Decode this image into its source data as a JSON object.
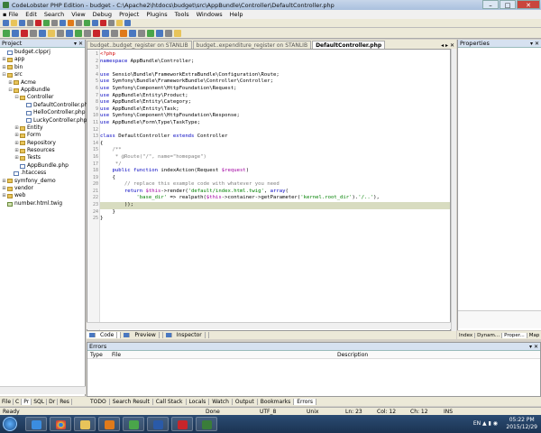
{
  "window": {
    "title": "CodeLobster PHP Edition - budget - C:\\Apache2\\htdocs\\budget\\src\\AppBundle\\Controller\\DefaultController.php"
  },
  "menu": [
    "File",
    "Edit",
    "Search",
    "View",
    "Debug",
    "Project",
    "Plugins",
    "Tools",
    "Windows",
    "Help"
  ],
  "project_panel": {
    "title": "Project",
    "tree": [
      {
        "label": "budget.clpprj",
        "depth": 0,
        "kind": "file",
        "exp": ""
      },
      {
        "label": "app",
        "depth": 0,
        "kind": "folder",
        "exp": "+"
      },
      {
        "label": "bin",
        "depth": 0,
        "kind": "folder",
        "exp": "+"
      },
      {
        "label": "src",
        "depth": 0,
        "kind": "folder",
        "exp": "-"
      },
      {
        "label": "Acme",
        "depth": 1,
        "kind": "folder",
        "exp": "+"
      },
      {
        "label": "AppBundle",
        "depth": 1,
        "kind": "folder",
        "exp": "-"
      },
      {
        "label": "Controller",
        "depth": 2,
        "kind": "folder",
        "exp": "-"
      },
      {
        "label": "DefaultController.php",
        "depth": 3,
        "kind": "file",
        "exp": ""
      },
      {
        "label": "HelloController.php",
        "depth": 3,
        "kind": "file",
        "exp": ""
      },
      {
        "label": "LuckyController.php",
        "depth": 3,
        "kind": "file",
        "exp": ""
      },
      {
        "label": "Entity",
        "depth": 2,
        "kind": "folder",
        "exp": "+"
      },
      {
        "label": "Form",
        "depth": 2,
        "kind": "folder",
        "exp": "+"
      },
      {
        "label": "Repository",
        "depth": 2,
        "kind": "folder",
        "exp": "+"
      },
      {
        "label": "Resources",
        "depth": 2,
        "kind": "folder",
        "exp": "+"
      },
      {
        "label": "Tests",
        "depth": 2,
        "kind": "folder",
        "exp": "+"
      },
      {
        "label": "AppBundle.php",
        "depth": 2,
        "kind": "file",
        "exp": ""
      },
      {
        "label": ".htaccess",
        "depth": 1,
        "kind": "file",
        "exp": ""
      },
      {
        "label": "symfony_demo",
        "depth": 0,
        "kind": "folder",
        "exp": "+"
      },
      {
        "label": "vendor",
        "depth": 0,
        "kind": "folder",
        "exp": "+"
      },
      {
        "label": "web",
        "depth": 0,
        "kind": "folder",
        "exp": "+"
      },
      {
        "label": "number.html.twig",
        "depth": 0,
        "kind": "twig",
        "exp": ""
      }
    ],
    "tabs": [
      "File",
      "C",
      "Pr",
      "SQL",
      "Dr",
      "Res"
    ]
  },
  "editor": {
    "tabs": [
      "budget..budget_register on STANLIB",
      "budget..expenditure_register on STANLIB",
      "DefaultController.php"
    ],
    "active_tab": 2,
    "view_tabs": [
      "Code",
      "Preview",
      "Inspector"
    ],
    "lines": [
      {
        "n": "1",
        "parts": [
          [
            "ph",
            "<?php"
          ]
        ]
      },
      {
        "n": "2",
        "parts": [
          [
            "kw",
            "namespace"
          ],
          [
            "",
            " AppBundle\\Controller;"
          ]
        ]
      },
      {
        "n": "3",
        "parts": []
      },
      {
        "n": "4",
        "parts": [
          [
            "kw",
            "use"
          ],
          [
            "",
            " Sensio\\Bundle\\FrameworkExtraBundle\\Configuration\\Route;"
          ]
        ]
      },
      {
        "n": "5",
        "parts": [
          [
            "kw",
            "use"
          ],
          [
            "",
            " Symfony\\Bundle\\FrameworkBundle\\Controller\\Controller;"
          ]
        ]
      },
      {
        "n": "6",
        "parts": [
          [
            "kw",
            "use"
          ],
          [
            "",
            " Symfony\\Component\\HttpFoundation\\Request;"
          ]
        ]
      },
      {
        "n": "7",
        "parts": [
          [
            "kw",
            "use"
          ],
          [
            "",
            " AppBundle\\Entity\\Product;"
          ]
        ]
      },
      {
        "n": "8",
        "parts": [
          [
            "kw",
            "use"
          ],
          [
            "",
            " AppBundle\\Entity\\Category;"
          ]
        ]
      },
      {
        "n": "9",
        "parts": [
          [
            "kw",
            "use"
          ],
          [
            "",
            " AppBundle\\Entity\\Task;"
          ]
        ]
      },
      {
        "n": "10",
        "parts": [
          [
            "kw",
            "use"
          ],
          [
            "",
            " Symfony\\Component\\HttpFoundation\\Response;"
          ]
        ]
      },
      {
        "n": "11",
        "parts": [
          [
            "kw",
            "use"
          ],
          [
            "",
            " AppBundle\\Form\\Type\\TaskType;"
          ]
        ]
      },
      {
        "n": "12",
        "parts": []
      },
      {
        "n": "13",
        "parts": [
          [
            "kw",
            "class"
          ],
          [
            "",
            " DefaultController "
          ],
          [
            "kw",
            "extends"
          ],
          [
            "",
            " Controller"
          ]
        ]
      },
      {
        "n": "14",
        "parts": [
          [
            "",
            "{"
          ]
        ]
      },
      {
        "n": "15",
        "parts": [
          [
            "cm",
            "    /**"
          ]
        ]
      },
      {
        "n": "16",
        "parts": [
          [
            "cm",
            "     * @Route(\"/\", name=\"homepage\")"
          ]
        ]
      },
      {
        "n": "17",
        "parts": [
          [
            "cm",
            "     */"
          ]
        ]
      },
      {
        "n": "18",
        "parts": [
          [
            "kw",
            "    public function"
          ],
          [
            "",
            " indexAction(Request "
          ],
          [
            "vr",
            "$request"
          ],
          [
            "",
            ")"
          ]
        ]
      },
      {
        "n": "19",
        "parts": [
          [
            "",
            "    {"
          ]
        ]
      },
      {
        "n": "20",
        "parts": [
          [
            "cm",
            "        // replace this example code with whatever you need"
          ]
        ]
      },
      {
        "n": "21",
        "parts": [
          [
            "kw",
            "        return"
          ],
          [
            "",
            " "
          ],
          [
            "vr",
            "$this"
          ],
          [
            "",
            "->render("
          ],
          [
            "st",
            "'default/index.html.twig'"
          ],
          [
            "",
            ", "
          ],
          [
            "kw",
            "array"
          ],
          [
            "",
            "("
          ]
        ]
      },
      {
        "n": "22",
        "parts": [
          [
            "st",
            "            'base_dir'"
          ],
          [
            "",
            " => realpath("
          ],
          [
            "vr",
            "$this"
          ],
          [
            "",
            "->container->getParameter("
          ],
          [
            "st",
            "'kernel.root_dir'"
          ],
          [
            "",
            ")."
          ],
          [
            "st",
            "'/..'"
          ],
          [
            "",
            "),"
          ]
        ]
      },
      {
        "n": "23",
        "parts": [
          [
            "",
            "        ));"
          ]
        ],
        "highlight": true
      },
      {
        "n": "24",
        "parts": [
          [
            "",
            "    }"
          ]
        ]
      },
      {
        "n": "25",
        "parts": [
          [
            "",
            "}"
          ]
        ]
      }
    ]
  },
  "properties_panel": {
    "title": "Properties",
    "tabs": [
      "Index",
      "Dynam...",
      "Proper...",
      "Map"
    ]
  },
  "errors_panel": {
    "title": "Errors",
    "columns": [
      "Type",
      "File",
      "Description"
    ]
  },
  "bottom_tabs": [
    "TODO",
    "Search Result",
    "Call Stack",
    "Locals",
    "Watch",
    "Output",
    "Bookmarks",
    "Errors"
  ],
  "status": {
    "state": "Ready",
    "done": "Done",
    "encoding": "UTF_8",
    "eol": "Unix",
    "line": "Ln: 23",
    "col": "Col: 12",
    "ch": "Ch: 12",
    "mode": "INS"
  },
  "taskbar": {
    "language": "EN",
    "time": "05:22 PM",
    "date": "2015/12/29"
  },
  "colors": {
    "keyword": "#0000c0",
    "php_tag": "#d00000",
    "comment": "#808080",
    "string": "#008000",
    "variable": "#a000a0",
    "highlight_line": "#d8dcc0"
  }
}
